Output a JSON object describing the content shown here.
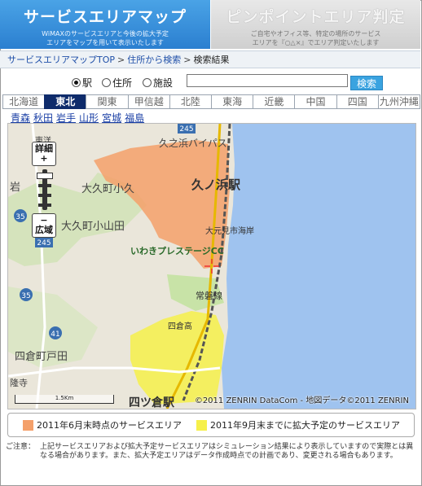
{
  "tabs": {
    "service_area_map": {
      "title": "サービスエリアマップ",
      "sub1": "WiMAXのサービスエリアと今後の拡大予定",
      "sub2": "エリアをマップを用いて表示いたします"
    },
    "pinpoint": {
      "title": "ピンポイントエリア判定",
      "sub1": "ご自宅やオフィス等、特定の場所のサービス",
      "sub2": "エリアを『○△×』でエリア判定いたします"
    }
  },
  "breadcrumb": {
    "top": "サービスエリアマップTOP",
    "sep1": ">",
    "address": "住所から検索",
    "sep2": ">",
    "current": "検索結果"
  },
  "search": {
    "options": [
      "駅",
      "住所",
      "施設"
    ],
    "selected": "駅",
    "value": "",
    "button": "検索"
  },
  "regions": [
    "北海道",
    "東北",
    "関東",
    "甲信越",
    "北陸",
    "東海",
    "近畿",
    "中国",
    "四国",
    "九州沖縄"
  ],
  "active_region": "東北",
  "prefectures": [
    "青森",
    "秋田",
    "岩手",
    "山形",
    "宮城",
    "福島"
  ],
  "map": {
    "zoom_in": "詳細",
    "zoom_in_sign": "+",
    "zoom_out": "広域",
    "zoom_out_sign": "−",
    "labels": {
      "hisanohama_bypass": "久之浜バイパス",
      "hisanohama_station": "久ノ浜駅",
      "okuhisa": "大久町小久",
      "okuhisa_oyamada": "大久町小山田",
      "beach": "大元見市海岸",
      "golf": "いわきプレステージCC",
      "joban_line": "常磐線",
      "yotsukura": "四倉高",
      "yotsukura_town": "四倉町戸田",
      "yotsukura_station": "四ツ倉駅",
      "iwa": "岩",
      "ryugu": "隆寺",
      "tohyo": "東洋",
      "route35": "35",
      "route35b": "35",
      "route41": "41",
      "route245": "245",
      "route245b": "245",
      "scale": "1.5Km"
    },
    "copyright": "©2011 ZENRIN DataCom - 地図データ©2011 ZENRIN"
  },
  "legend": {
    "current": "2011年6月末時点のサービスエリア",
    "planned": "2011年9月末までに拡大予定のサービスエリア",
    "current_color": "#f4a06a",
    "planned_color": "#f6f04a"
  },
  "note": {
    "label": "ご注意：",
    "text": "上記サービスエリアおよび拡大予定サービスエリアはシミュレーション結果により表示していますので実際とは異なる場合があります。また、拡大予定エリアはデータ作成時点での計画であり、変更される場合もあります。"
  }
}
